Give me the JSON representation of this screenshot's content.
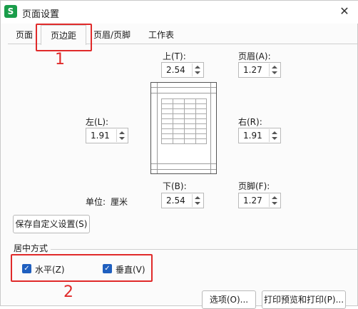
{
  "window": {
    "title": "页面设置",
    "app_icon": "S"
  },
  "tabs": [
    {
      "label": "页面",
      "active": false
    },
    {
      "label": "页边距",
      "active": true
    },
    {
      "label": "页眉/页脚",
      "active": false
    },
    {
      "label": "工作表",
      "active": false
    }
  ],
  "margins": {
    "top": {
      "label": "上(T):",
      "value": "2.54"
    },
    "header": {
      "label": "页眉(A):",
      "value": "1.27"
    },
    "left": {
      "label": "左(L):",
      "value": "1.91"
    },
    "right": {
      "label": "右(R):",
      "value": "1.91"
    },
    "bottom": {
      "label": "下(B):",
      "value": "2.54"
    },
    "footer": {
      "label": "页脚(F):",
      "value": "1.27"
    }
  },
  "unit": {
    "label": "单位:",
    "value": "厘米"
  },
  "save_custom": "保存自定义设置(S)",
  "center": {
    "group_label": "居中方式",
    "horizontal": {
      "label": "水平(Z)",
      "checked": true
    },
    "vertical": {
      "label": "垂直(V)",
      "checked": true
    }
  },
  "buttons": {
    "options": "选项(O)...",
    "print_preview": "打印预览和打印(P)..."
  },
  "annotations": {
    "num1": "1",
    "num2": "2"
  },
  "colors": {
    "accent": "#1f5fbf",
    "annotation": "#e02a2a",
    "app_icon": "#1a9d4a"
  }
}
